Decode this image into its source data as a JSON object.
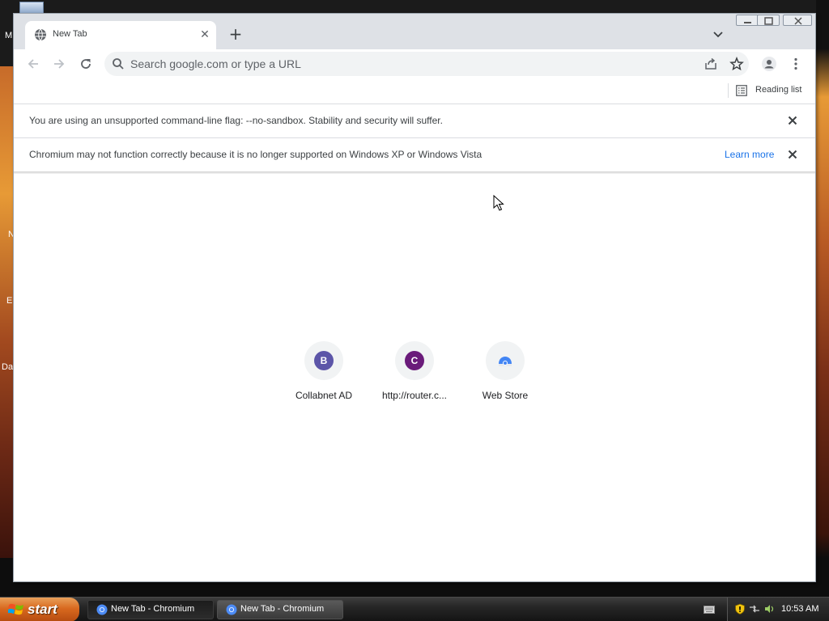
{
  "desktop": {
    "icon_labels": [
      "M",
      "N",
      "E",
      "Da"
    ]
  },
  "browser": {
    "tab": {
      "title": "New Tab",
      "close_glyph": "✕",
      "favicon": "globe-icon"
    },
    "new_tab_glyph": "+",
    "toolbar": {
      "omnibox_placeholder": "Search google.com or type a URL",
      "omnibox_value": ""
    },
    "bookmarks_bar": {
      "reading_list_label": "Reading list"
    },
    "infobars": [
      {
        "text": "You are using an unsupported command-line flag: --no-sandbox. Stability and security will suffer.",
        "link": ""
      },
      {
        "text": "Chromium may not function correctly because it is no longer supported on Windows XP or Windows Vista",
        "link": "Learn more"
      }
    ],
    "shortcuts": [
      {
        "letter": "B",
        "label": "Collabnet AD",
        "color": "#5c55a8"
      },
      {
        "letter": "C",
        "label": "http://router.c...",
        "color": "#6a1b7a"
      },
      {
        "letter": "",
        "label": "Web Store",
        "color": "#4285f4"
      }
    ]
  },
  "taskbar": {
    "start_label": "start",
    "tasks": [
      {
        "label": "New Tab - Chromium",
        "active": true
      },
      {
        "label": "New Tab - Chromium",
        "active": false
      }
    ],
    "clock": "10:53 AM"
  },
  "colors": {
    "accent": "#1a73e8",
    "tabstrip": "#dee1e6",
    "omnibox": "#f1f3f4"
  }
}
